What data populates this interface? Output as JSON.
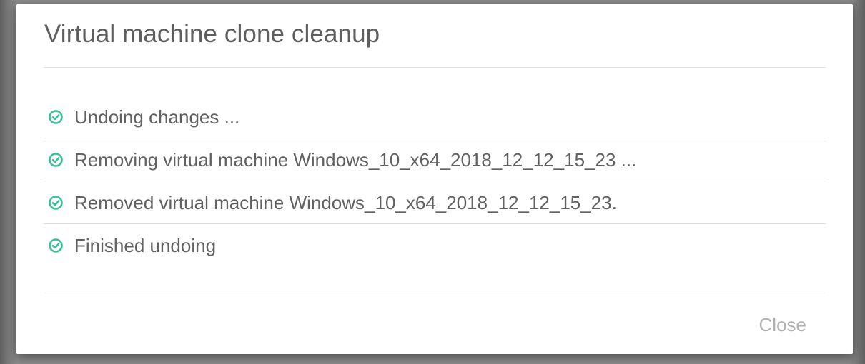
{
  "dialog": {
    "title": "Virtual machine clone cleanup",
    "close_label": "Close"
  },
  "steps": [
    {
      "label": "Undoing changes ...",
      "status": "completed",
      "icon": "check-circle-icon"
    },
    {
      "label": "Removing virtual machine Windows_10_x64_2018_12_12_15_23 ...",
      "status": "completed",
      "icon": "check-circle-icon"
    },
    {
      "label": "Removed virtual machine Windows_10_x64_2018_12_12_15_23.",
      "status": "completed",
      "icon": "check-circle-icon"
    },
    {
      "label": "Finished undoing",
      "status": "completed",
      "icon": "check-circle-icon"
    }
  ],
  "colors": {
    "success": "#3dbf99",
    "title_text": "#5e5e5e",
    "body_text": "#616161",
    "button_text": "#b0b0b0"
  }
}
